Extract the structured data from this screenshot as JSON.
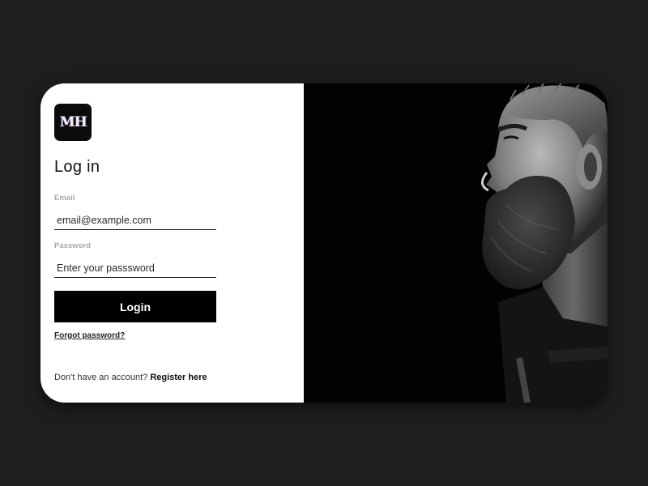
{
  "brand": {
    "logo_text": "MH"
  },
  "form": {
    "title": "Log in",
    "email_label": "Email",
    "email_placeholder": "email@example.com",
    "password_label": "Password",
    "password_placeholder": "Enter your passsword",
    "login_label": "Login",
    "forgot_label": "Forgot password?",
    "register_prompt": "Don't have an account?",
    "register_label": "Register here"
  },
  "hero": {
    "image_description": "black and white profile photo of a bearded man"
  },
  "colors": {
    "background": "#1e1e1e",
    "button": "#000000",
    "panel": "#ffffff"
  }
}
